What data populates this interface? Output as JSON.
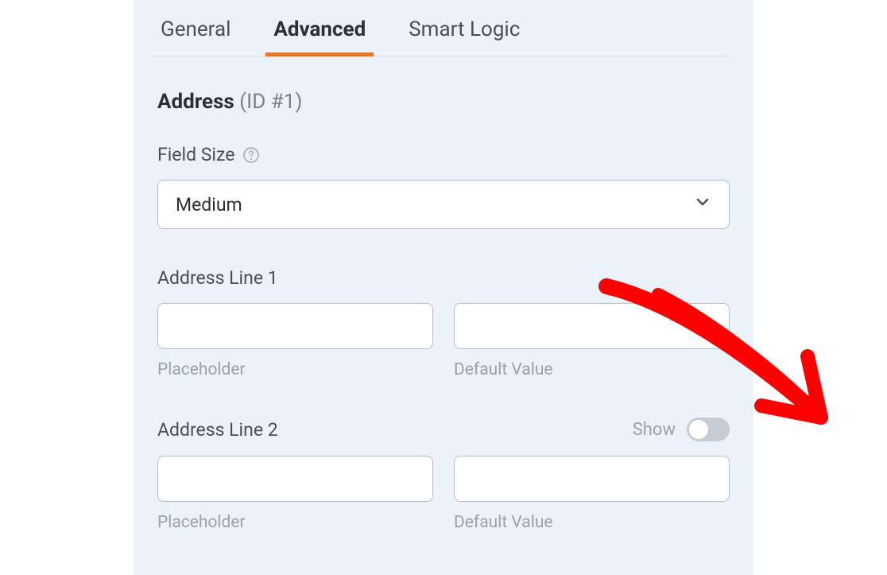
{
  "tabs": {
    "general": "General",
    "advanced": "Advanced",
    "smart_logic": "Smart Logic"
  },
  "section": {
    "title": "Address",
    "id_text": "(ID #1)"
  },
  "field_size": {
    "label": "Field Size",
    "value": "Medium"
  },
  "line1": {
    "title": "Address Line 1",
    "placeholder_label": "Placeholder",
    "default_label": "Default Value"
  },
  "line2": {
    "title": "Address Line 2",
    "show_label": "Show",
    "placeholder_label": "Placeholder",
    "default_label": "Default Value"
  }
}
